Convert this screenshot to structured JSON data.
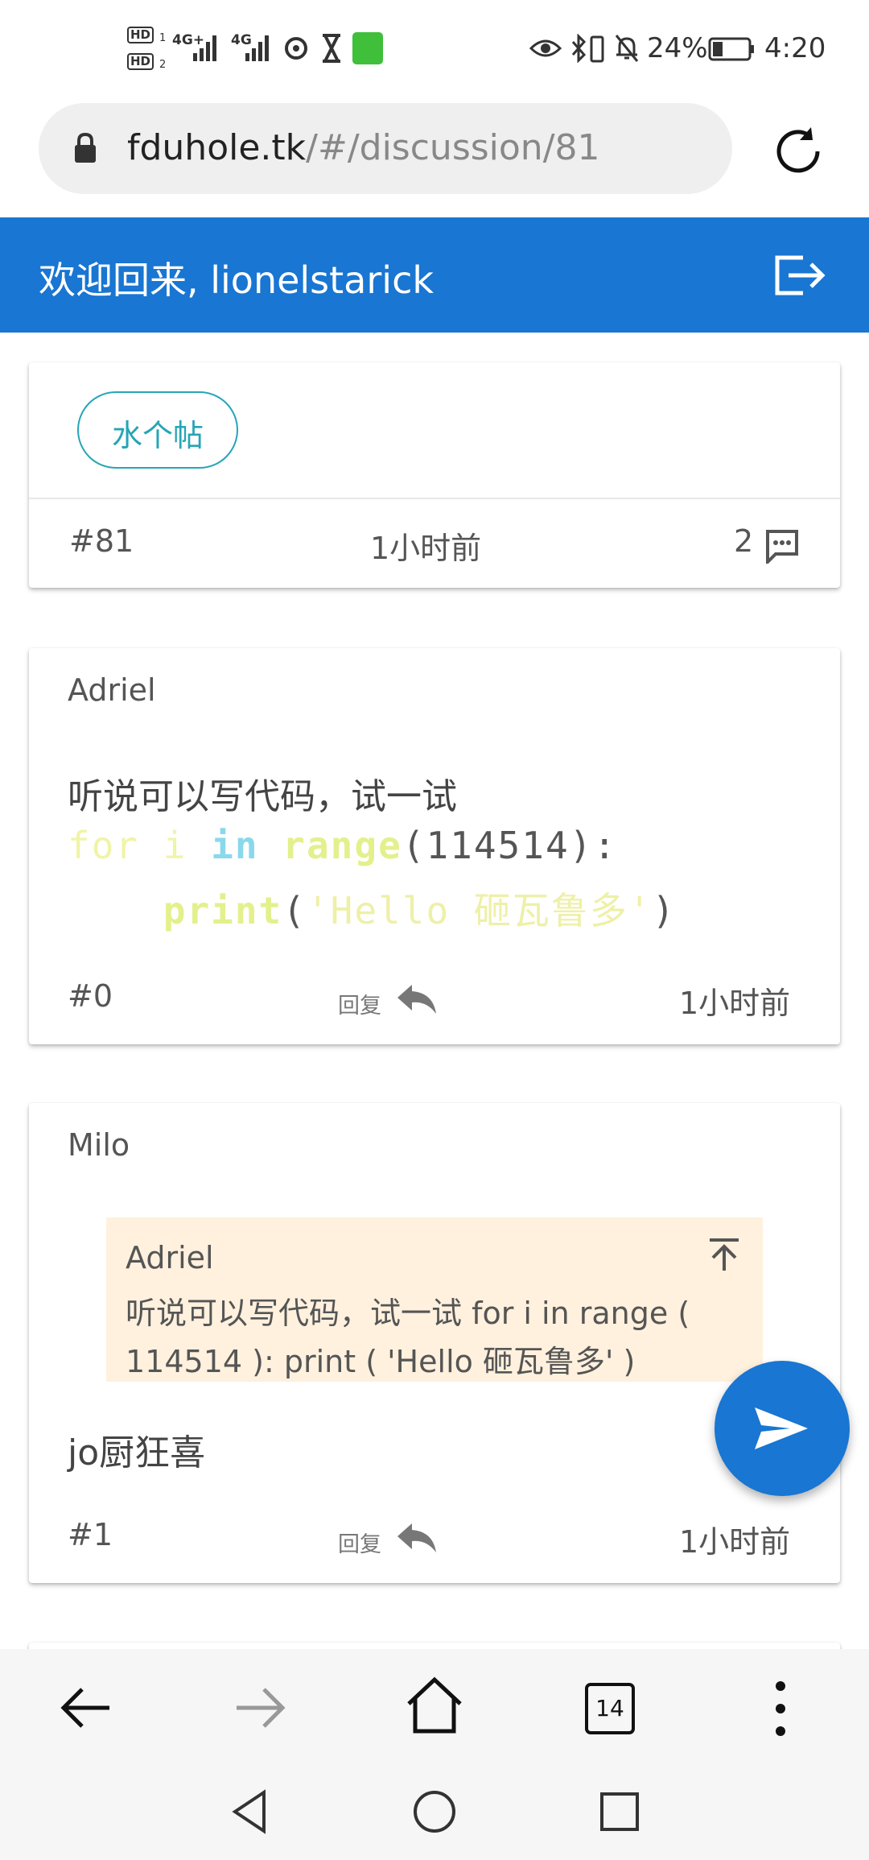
{
  "status_bar": {
    "hd1": "HD",
    "hd2": "HD",
    "net1": "4G+",
    "net2": "4G",
    "battery": "24%",
    "time": "4:20"
  },
  "browser": {
    "url_domain": "fduhole.tk",
    "url_path": "/#/discussion/81",
    "tab_count": "14"
  },
  "header": {
    "welcome": "欢迎回来, lionelstarick"
  },
  "discussion": {
    "tag": "水个帖",
    "id": "#81",
    "time": "1小时前",
    "reply_count": "2"
  },
  "posts": [
    {
      "author": "Adriel",
      "text": "听说可以写代码，试一试",
      "code": {
        "kw_for": "for",
        "var_i": "i",
        "kw_in": "in",
        "fn_range": "range",
        "range_arg": "(114514):",
        "fn_print": "print",
        "paren_open": "(",
        "string": "'Hello 砸瓦鲁多'",
        "paren_close": ")"
      },
      "number": "#0",
      "reply_label": "回复",
      "time": "1小时前"
    },
    {
      "author": "Milo",
      "quote": {
        "author": "Adriel",
        "line1": "听说可以写代码，试一试 for i in range (",
        "line2": "114514 ): print ( 'Hello 砸瓦鲁多' )"
      },
      "text": "jo厨狂喜",
      "number": "#1",
      "reply_label": "回复",
      "time": "1小时前"
    }
  ],
  "colors": {
    "primary": "#1976d2",
    "tag_border": "#26a5b6",
    "quote_bg": "#fff1de"
  }
}
